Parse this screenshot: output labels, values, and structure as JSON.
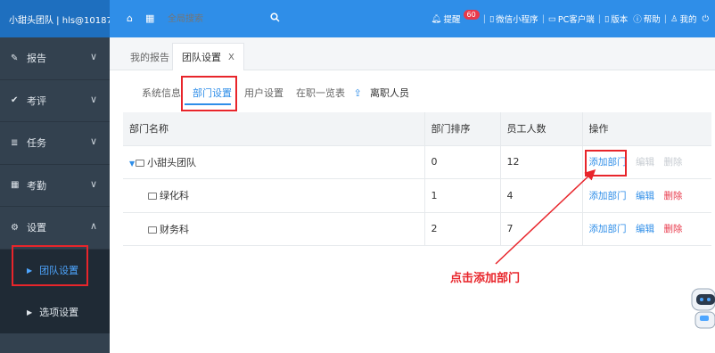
{
  "header": {
    "brand": "小甜头团队 | hls@10187",
    "search_placeholder": "全局搜索",
    "items": [
      {
        "icon": "bell-icon",
        "label": "提醒",
        "badge": "60"
      },
      {
        "icon": "mobile-icon",
        "label": "微信小程序"
      },
      {
        "icon": "desktop-icon",
        "label": "PC客户端"
      },
      {
        "icon": "book-icon",
        "label": "版本"
      },
      {
        "icon": "help-icon",
        "label": "帮助"
      },
      {
        "icon": "user-icon",
        "label": "我的"
      }
    ]
  },
  "sidebar": {
    "items": [
      {
        "icon": "edit-icon",
        "label": "报告"
      },
      {
        "icon": "check-icon",
        "label": "考评"
      },
      {
        "icon": "list-icon",
        "label": "任务"
      },
      {
        "icon": "calendar-icon",
        "label": "考勤"
      },
      {
        "icon": "gear-icon",
        "label": "设置"
      }
    ],
    "sub_items": [
      {
        "label": "团队设置"
      },
      {
        "label": "选项设置"
      }
    ]
  },
  "page_tabs": [
    {
      "label": "我的报告"
    },
    {
      "label": "团队设置",
      "close": "X"
    }
  ],
  "sub_tabs": [
    {
      "label": "系统信息"
    },
    {
      "label": "部门设置"
    },
    {
      "label": "用户设置"
    },
    {
      "label": "在职一览表"
    },
    {
      "label": "离职人员"
    }
  ],
  "table": {
    "headers": [
      "部门名称",
      "部门排序",
      "员工人数",
      "操作"
    ],
    "rows": [
      {
        "name": "小甜头团队",
        "sort": "0",
        "count": "12"
      },
      {
        "name": "绿化科",
        "sort": "1",
        "count": "4"
      },
      {
        "name": "财务科",
        "sort": "2",
        "count": "7"
      }
    ],
    "actions": {
      "add": "添加部门",
      "edit": "编辑",
      "delete": "删除"
    }
  },
  "annotation": "点击添加部门",
  "colors": {
    "primary": "#2f8ee8",
    "sidebar": "#33414f",
    "highlight": "#e8252b",
    "danger": "#e8394b"
  }
}
